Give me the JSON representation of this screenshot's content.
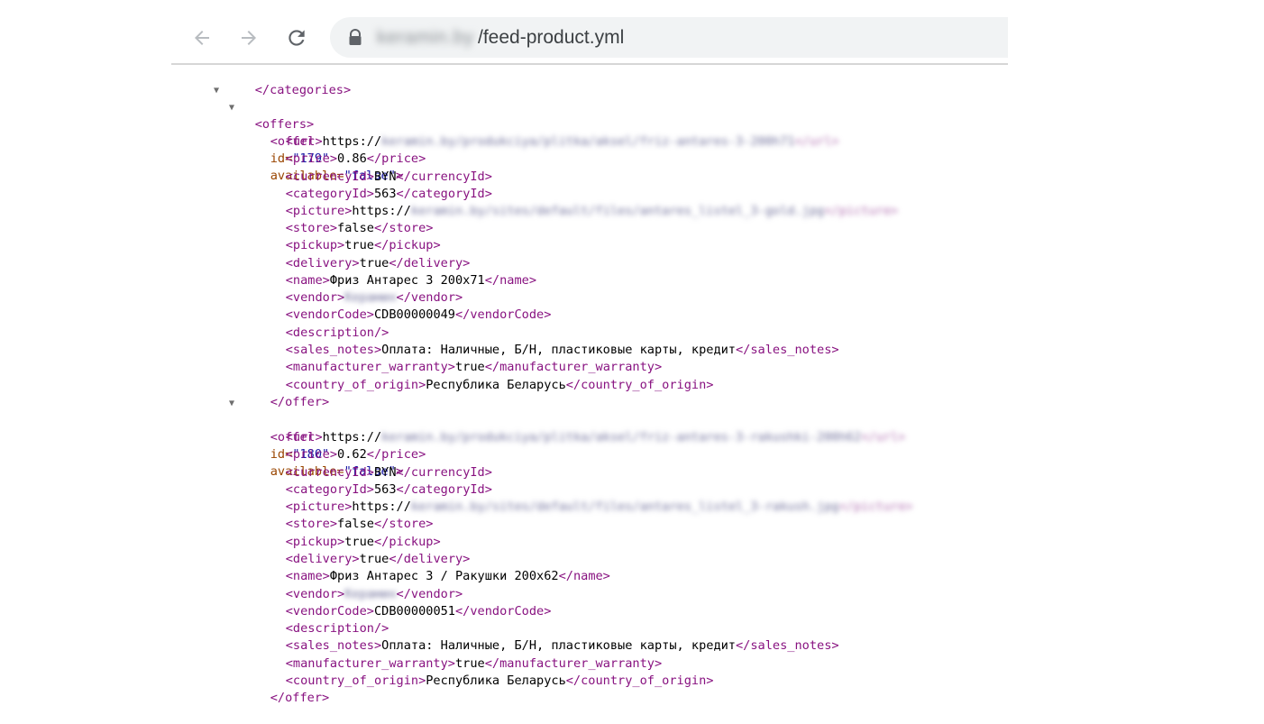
{
  "browser": {
    "nav": {
      "back_icon": "arrow-left-icon",
      "forward_icon": "arrow-right-icon",
      "reload_icon": "reload-icon"
    },
    "address_bar": {
      "lock_icon": "lock-icon",
      "domain": "keramin.by",
      "path": "/feed-product.yml"
    }
  },
  "xml": {
    "categories_close": "</categories>",
    "offers_open": "<offers>",
    "offers": [
      {
        "offer_open_tag": "<offer",
        "id_attr": "id=",
        "id_value": "\"179\"",
        "available_attr": "available=",
        "available_value": "\"false\"",
        "open_bracket_end": ">",
        "url_prefix": "https://",
        "url_blurred": "keramin.by/produkciya/plitka/aksel/friz-antares-3-200h71",
        "url_close": "</url>",
        "price": "0.86",
        "currencyId": "BYN",
        "categoryId": "563",
        "picture_prefix": "https://",
        "picture_blurred": "keramin.by/sites/default/files/antares_listel_3-gold.jpg",
        "picture_close": "</picture>",
        "store": "false",
        "pickup": "true",
        "delivery": "true",
        "name": "Фриз Антарес 3 200х71",
        "vendor_blurred": "Керамин",
        "vendorCode": "CDB00000049",
        "description": "<description/>",
        "sales_notes": "Оплата: Наличные, Б/Н, пластиковые карты, кредит",
        "manufacturer_warranty": "true",
        "country_of_origin": "Республика Беларусь",
        "offer_close": "</offer>"
      },
      {
        "offer_open_tag": "<offer",
        "id_attr": "id=",
        "id_value": "\"180\"",
        "available_attr": "available=",
        "available_value": "\"false\"",
        "open_bracket_end": ">",
        "url_prefix": "https://",
        "url_blurred": "keramin.by/produkciya/plitka/aksel/friz-antares-3-rakushki-200h62",
        "url_close": "</url>",
        "price": "0.62",
        "currencyId": "BYN",
        "categoryId": "563",
        "picture_prefix": "https://",
        "picture_blurred": "keramin.by/sites/default/files/antares_listel_3-rakush.jpg",
        "picture_close": "</picture>",
        "store": "false",
        "pickup": "true",
        "delivery": "true",
        "name": "Фриз Антарес 3 / Ракушки 200х62",
        "vendor_blurred": "Керамин",
        "vendorCode": "CDB00000051",
        "description": "<description/>",
        "sales_notes": "Оплата: Наличные, Б/Н, пластиковые карты, кредит",
        "manufacturer_warranty": "true",
        "country_of_origin": "Республика Беларусь",
        "offer_close": "</offer>"
      }
    ],
    "tags": {
      "url_open": "<url>",
      "price_open": "<price>",
      "price_close": "</price>",
      "currency_open": "<currencyId>",
      "currency_close": "</currencyId>",
      "category_open": "<categoryId>",
      "category_close": "</categoryId>",
      "picture_open": "<picture>",
      "store_open": "<store>",
      "store_close": "</store>",
      "pickup_open": "<pickup>",
      "pickup_close": "</pickup>",
      "delivery_open": "<delivery>",
      "delivery_close": "</delivery>",
      "name_open": "<name>",
      "name_close": "</name>",
      "vendor_open": "<vendor>",
      "vendor_close": "</vendor>",
      "vendorcode_open": "<vendorCode>",
      "vendorcode_close": "</vendorCode>",
      "sales_open": "<sales_notes>",
      "sales_close": "</sales_notes>",
      "warranty_open": "<manufacturer_warranty>",
      "warranty_close": "</manufacturer_warranty>",
      "country_open": "<country_of_origin>",
      "country_close": "</country_of_origin>"
    },
    "toggle_glyph": "▼"
  },
  "colors": {
    "tag": "#881280",
    "attribute": "#994500",
    "attribute_value": "#1a1aa6",
    "text": "#000000"
  }
}
